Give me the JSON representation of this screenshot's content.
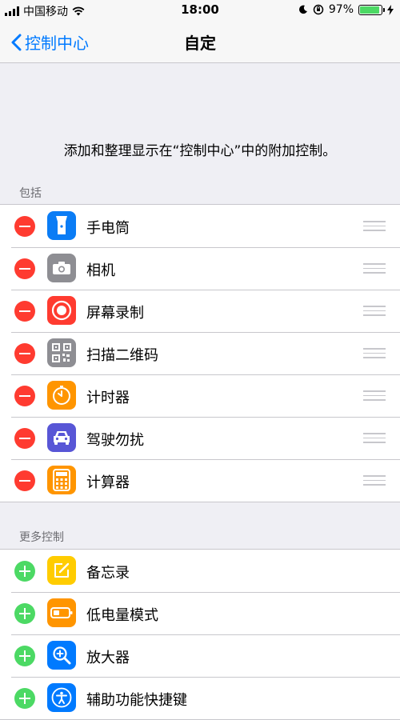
{
  "status_bar": {
    "carrier": "中国移动",
    "time": "18:00",
    "battery_percent": "97%",
    "battery_level": 0.97
  },
  "nav": {
    "back_label": "控制中心",
    "title": "自定"
  },
  "description": "添加和整理显示在“控制中心”中的附加控制。",
  "included": {
    "header": "包括",
    "items": [
      {
        "label": "手电筒",
        "icon": "flashlight-icon",
        "color": "#0a7cf5"
      },
      {
        "label": "相机",
        "icon": "camera-icon",
        "color": "#8e8e93"
      },
      {
        "label": "屏幕录制",
        "icon": "screen-record-icon",
        "color": "#ff3b30"
      },
      {
        "label": "扫描二维码",
        "icon": "qr-code-icon",
        "color": "#8e8e93"
      },
      {
        "label": "计时器",
        "icon": "timer-icon",
        "color": "#ff9500"
      },
      {
        "label": "驾驶勿扰",
        "icon": "car-icon",
        "color": "#5856d6"
      },
      {
        "label": "计算器",
        "icon": "calculator-icon",
        "color": "#ff9500"
      }
    ]
  },
  "more": {
    "header": "更多控制",
    "items": [
      {
        "label": "备忘录",
        "icon": "notes-icon",
        "color": "#ffcc00"
      },
      {
        "label": "低电量模式",
        "icon": "low-power-icon",
        "color": "#ff9500"
      },
      {
        "label": "放大器",
        "icon": "magnifier-icon",
        "color": "#007aff"
      },
      {
        "label": "辅助功能快捷键",
        "icon": "accessibility-icon",
        "color": "#007aff"
      }
    ]
  }
}
